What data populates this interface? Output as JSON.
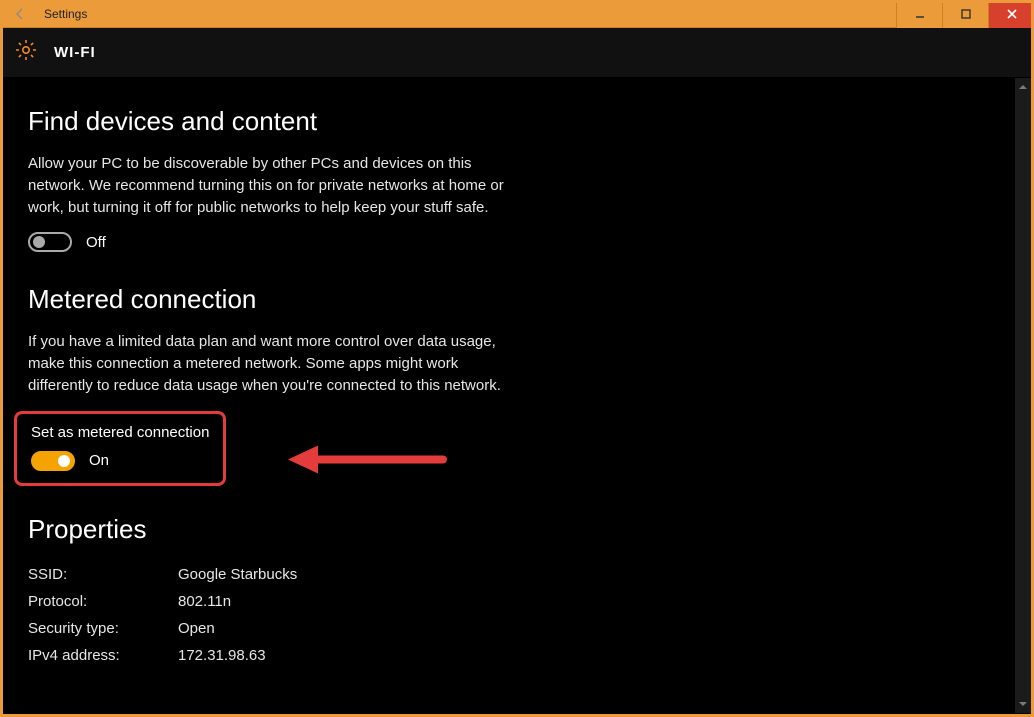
{
  "titlebar": {
    "title": "Settings"
  },
  "header": {
    "page_title": "WI-FI"
  },
  "section1": {
    "heading": "Find devices and content",
    "desc": "Allow your PC to be discoverable by other PCs and devices on this network. We recommend turning this on for private networks at home or work, but turning it off for public networks to help keep your stuff safe.",
    "toggle_state": "Off"
  },
  "section2": {
    "heading": "Metered connection",
    "desc": "If you have a limited data plan and want more control over data usage, make this connection a metered network. Some apps might work differently to reduce data usage when you're connected to this network.",
    "sublabel": "Set as metered connection",
    "toggle_state": "On"
  },
  "section3": {
    "heading": "Properties",
    "rows": [
      {
        "k": "SSID:",
        "v": "Google Starbucks"
      },
      {
        "k": "Protocol:",
        "v": "802.11n"
      },
      {
        "k": "Security type:",
        "v": "Open"
      },
      {
        "k": "IPv4 address:",
        "v": "172.31.98.63"
      }
    ]
  }
}
